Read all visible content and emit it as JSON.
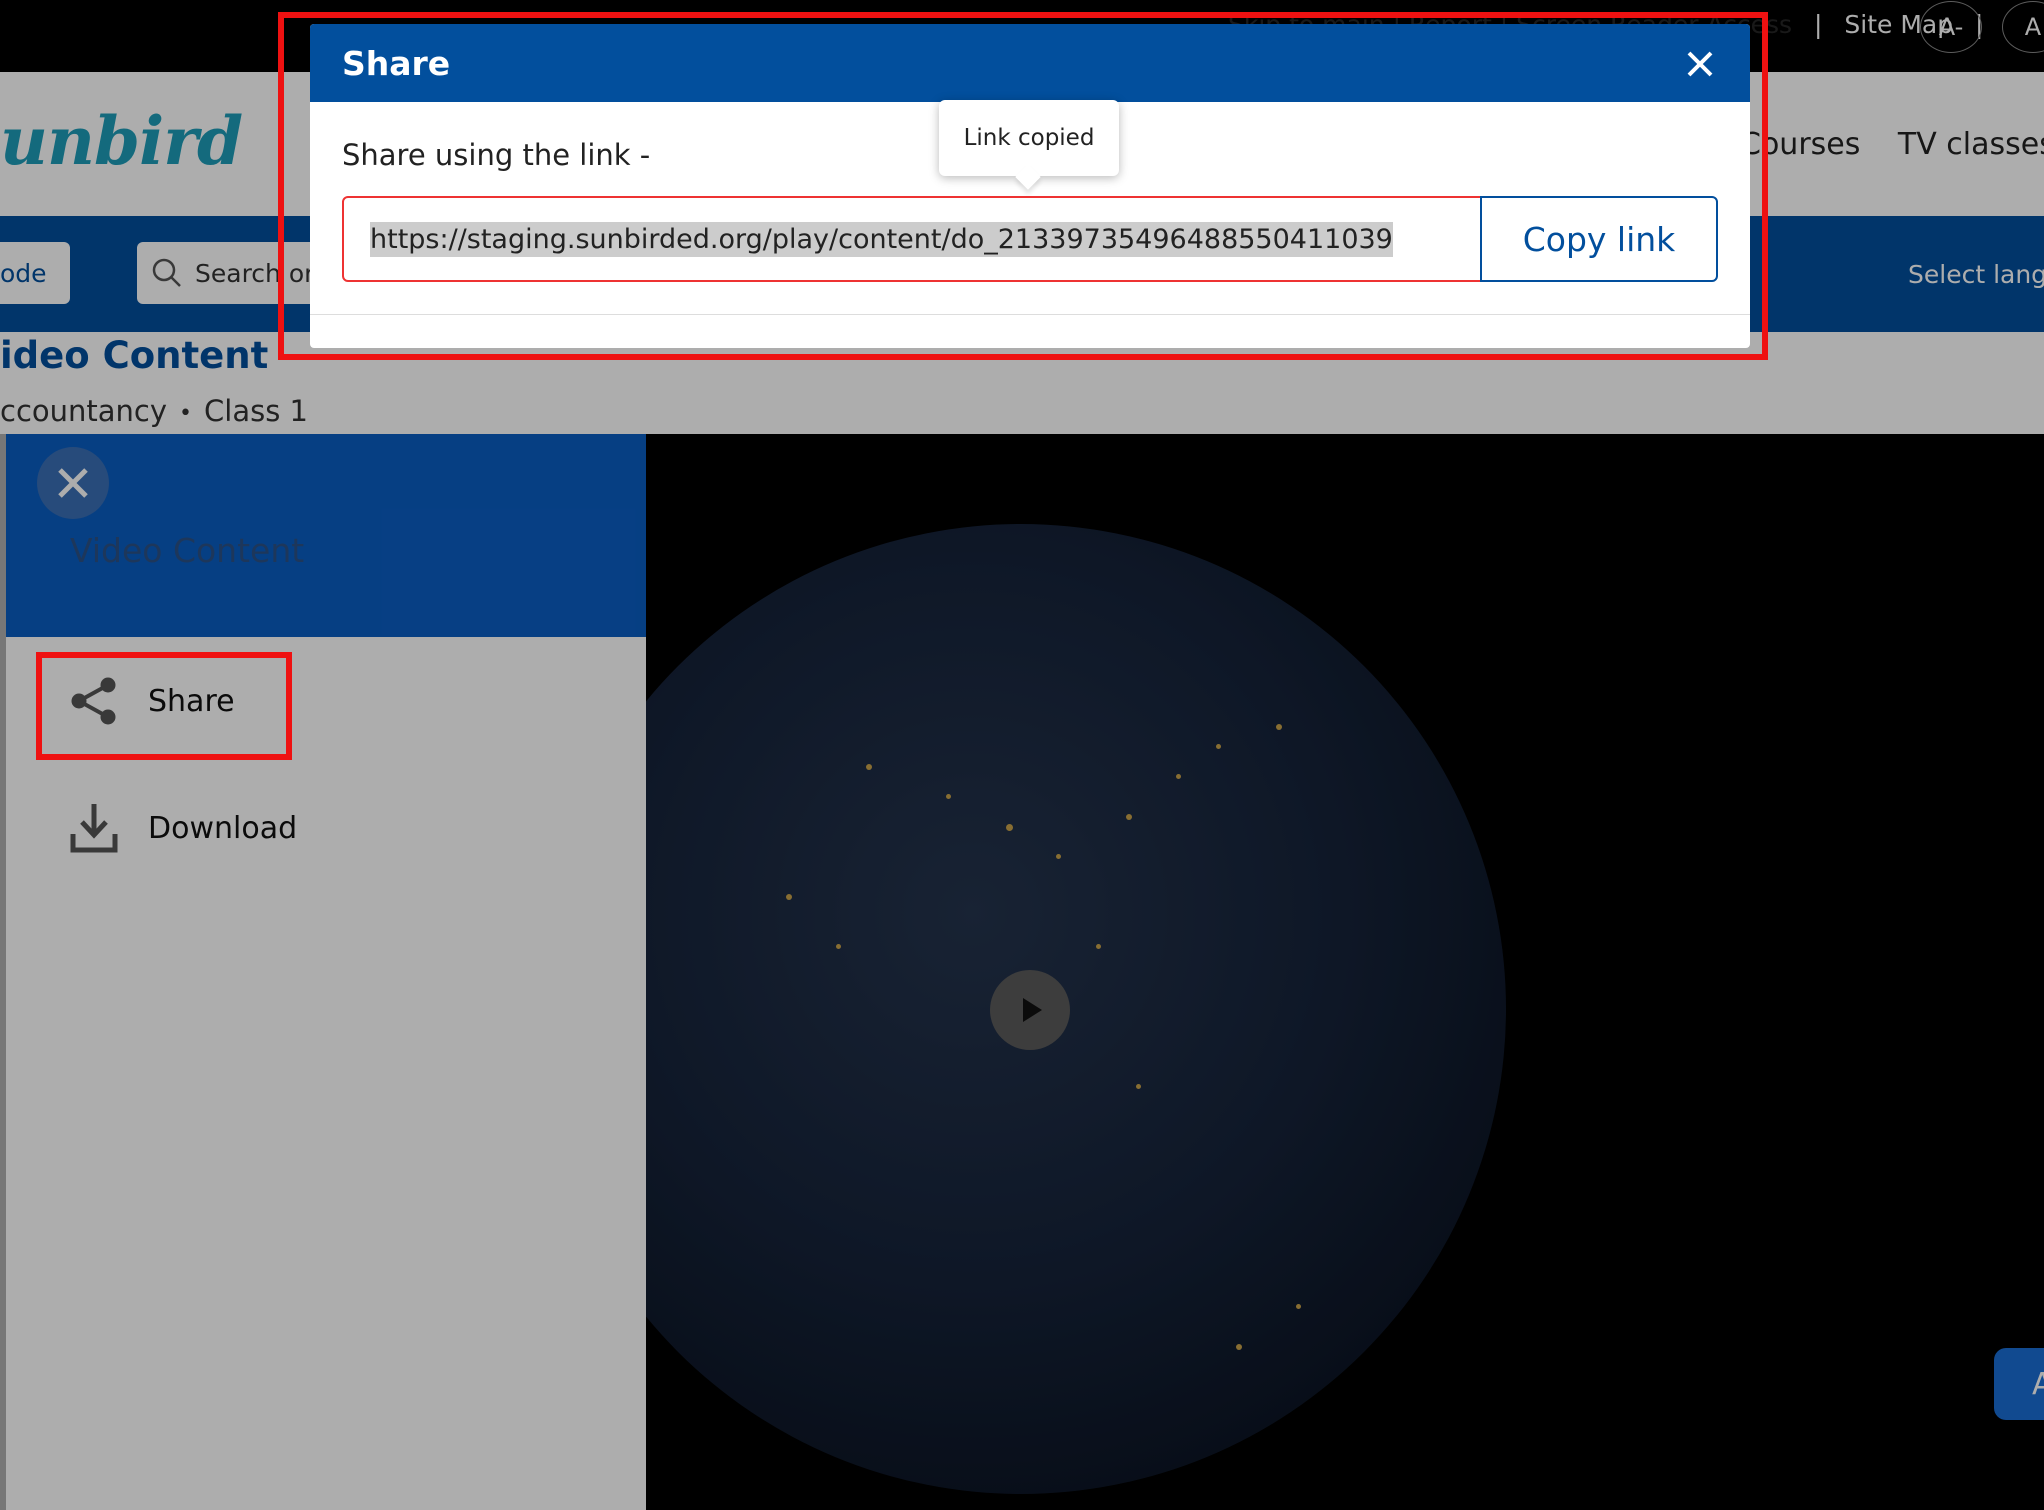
{
  "topbar": {
    "links_obscured": "Skip to main | Report | Screen Reader Access",
    "sitemap": "Site Map",
    "separator": "|",
    "font_decrease": "A-",
    "font_normal": "A"
  },
  "header": {
    "logo_text": "unbird",
    "nav": [
      "Courses",
      "TV classes"
    ]
  },
  "searchbar": {
    "code_label": "ode",
    "search_placeholder": "Search or",
    "select_language": "Select langu"
  },
  "content": {
    "title": "ideo Content",
    "meta_subject": "ccountancy",
    "meta_dot": "•",
    "meta_class": "Class 1"
  },
  "side_panel": {
    "title": "Video Content",
    "menu": [
      {
        "label": "Share",
        "icon": "share-icon"
      },
      {
        "label": "Download",
        "icon": "download-icon"
      }
    ]
  },
  "player": {
    "play_icon": "play-icon"
  },
  "side_tab": {
    "label": "A"
  },
  "modal": {
    "title": "Share",
    "share_label": "Share using the link -",
    "link": "https://staging.sunbirded.org/play/content/do_21339735496488550411039",
    "copy_label": "Copy link",
    "tooltip": "Link copied"
  },
  "colors": {
    "brand_blue": "#024f9d",
    "annotation_red": "#ee1111",
    "logo_teal": "#1e9db8"
  }
}
